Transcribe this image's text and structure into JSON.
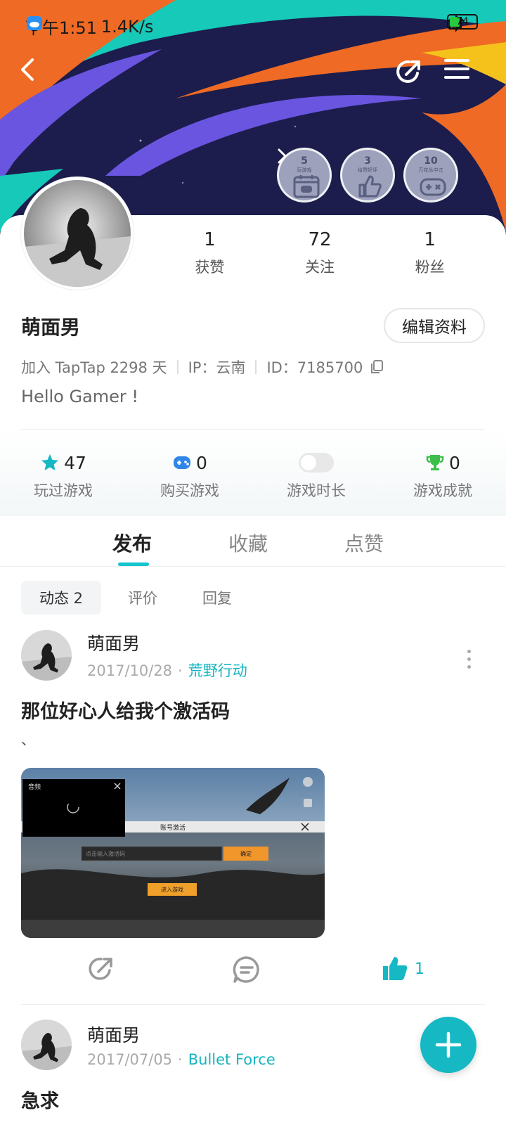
{
  "status_bar": {
    "time": "下午1:51",
    "net_speed": "1.4K/s",
    "battery": "74"
  },
  "badges": [
    {
      "count": "5",
      "caption": "玩游戏"
    },
    {
      "count": "3",
      "caption": "给赞好评"
    },
    {
      "count": "10",
      "caption": "万花丛中过"
    }
  ],
  "profile": {
    "name": "萌面男",
    "edit_label": "编辑资料",
    "join_text": "加入 TapTap 2298 天",
    "ip_text": "IP：云南",
    "id_text": "ID：7185700",
    "bio": "Hello Gamer !"
  },
  "stats": [
    {
      "value": "1",
      "label": "获赞"
    },
    {
      "value": "72",
      "label": "关注"
    },
    {
      "value": "1",
      "label": "粉丝"
    }
  ],
  "game_stats": {
    "played": {
      "value": "47",
      "label": "玩过游戏"
    },
    "bought": {
      "value": "0",
      "label": "购买游戏"
    },
    "duration": {
      "label": "游戏时长"
    },
    "achievements": {
      "value": "0",
      "label": "游戏成就"
    }
  },
  "tabs": [
    "发布",
    "收藏",
    "点赞"
  ],
  "subtabs": [
    "动态 2",
    "评价",
    "回复"
  ],
  "posts": [
    {
      "author": "萌面男",
      "date": "2017/10/28",
      "game": "荒野行动",
      "title": "那位好心人给我个激活码",
      "body": "、",
      "likes": "1",
      "screenshot": {
        "video_label": "音频",
        "dialog_title": "账号激活",
        "input_placeholder": "点击输入激活码",
        "confirm_label": "确定",
        "enter_label": "进入游戏"
      }
    },
    {
      "author": "萌面男",
      "date": "2017/07/05",
      "game": "Bullet Force",
      "title": "急求"
    }
  ],
  "colors": {
    "accent": "#15b8c3",
    "banner_bg": "#1b1c4a",
    "banner_orange": "#ef6a24",
    "banner_purple": "#6a55e0",
    "banner_teal": "#16c9b9"
  }
}
